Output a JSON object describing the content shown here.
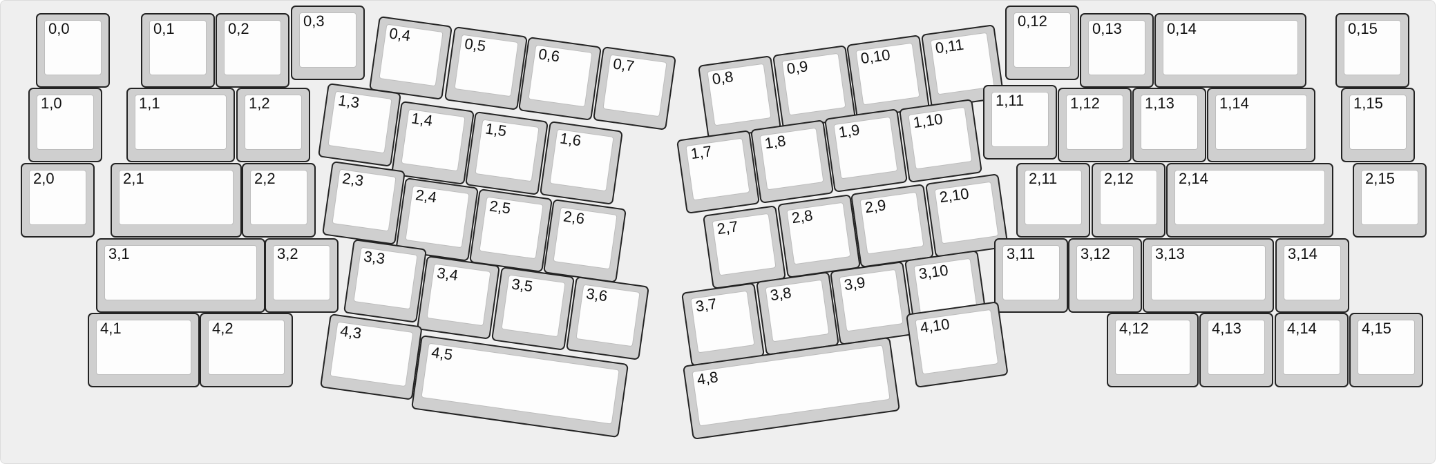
{
  "layout": {
    "keys": [
      {
        "label": "0,0"
      },
      {
        "label": "0,1"
      },
      {
        "label": "0,2"
      },
      {
        "label": "0,3"
      },
      {
        "label": "0,4"
      },
      {
        "label": "0,5"
      },
      {
        "label": "0,6"
      },
      {
        "label": "0,7"
      },
      {
        "label": "0,8"
      },
      {
        "label": "0,9"
      },
      {
        "label": "0,10"
      },
      {
        "label": "0,11"
      },
      {
        "label": "0,12"
      },
      {
        "label": "0,13"
      },
      {
        "label": "0,14"
      },
      {
        "label": "0,15"
      },
      {
        "label": "1,0"
      },
      {
        "label": "1,1"
      },
      {
        "label": "1,2"
      },
      {
        "label": "1,3"
      },
      {
        "label": "1,4"
      },
      {
        "label": "1,5"
      },
      {
        "label": "1,6"
      },
      {
        "label": "1,7"
      },
      {
        "label": "1,8"
      },
      {
        "label": "1,9"
      },
      {
        "label": "1,10"
      },
      {
        "label": "1,11"
      },
      {
        "label": "1,12"
      },
      {
        "label": "1,13"
      },
      {
        "label": "1,14"
      },
      {
        "label": "1,15"
      },
      {
        "label": "2,0"
      },
      {
        "label": "2,1"
      },
      {
        "label": "2,2"
      },
      {
        "label": "2,3"
      },
      {
        "label": "2,4"
      },
      {
        "label": "2,5"
      },
      {
        "label": "2,6"
      },
      {
        "label": "2,7"
      },
      {
        "label": "2,8"
      },
      {
        "label": "2,9"
      },
      {
        "label": "2,10"
      },
      {
        "label": "2,11"
      },
      {
        "label": "2,12"
      },
      {
        "label": "2,14"
      },
      {
        "label": "2,15"
      },
      {
        "label": "3,1"
      },
      {
        "label": "3,2"
      },
      {
        "label": "3,3"
      },
      {
        "label": "3,4"
      },
      {
        "label": "3,5"
      },
      {
        "label": "3,6"
      },
      {
        "label": "3,7"
      },
      {
        "label": "3,8"
      },
      {
        "label": "3,9"
      },
      {
        "label": "3,10"
      },
      {
        "label": "3,11"
      },
      {
        "label": "3,12"
      },
      {
        "label": "3,13"
      },
      {
        "label": "3,14"
      },
      {
        "label": "4,1"
      },
      {
        "label": "4,2"
      },
      {
        "label": "4,3"
      },
      {
        "label": "4,5"
      },
      {
        "label": "4,8"
      },
      {
        "label": "4,10"
      },
      {
        "label": "4,12"
      },
      {
        "label": "4,13"
      },
      {
        "label": "4,14"
      },
      {
        "label": "4,15"
      }
    ]
  },
  "colors": {
    "background": "#efefef",
    "key_border": "#232323",
    "key_base": "#cfcfcf",
    "key_top": "#fdfdfd",
    "legend_text": "#111111"
  }
}
